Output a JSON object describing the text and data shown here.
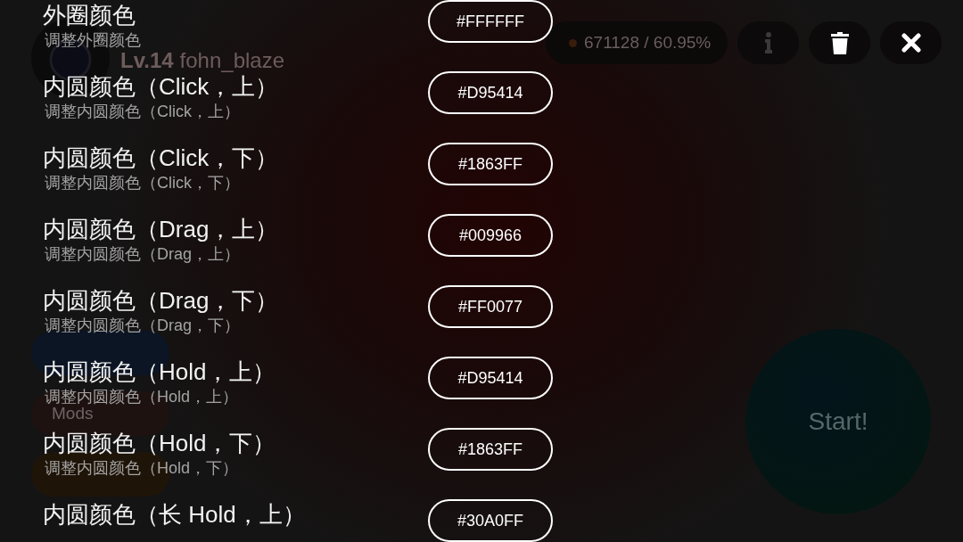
{
  "background": {
    "player": {
      "level": "Lv.14",
      "username": "fohn_blaze"
    },
    "score": "671128 / 60.95%",
    "side_pills": [
      {
        "color": "#0c1524"
      },
      {
        "label": "Mods",
        "color": "#1d1210"
      },
      {
        "color": "#1f1408"
      }
    ],
    "start_button": "Start!"
  },
  "settings": [
    {
      "title": "外圈颜色",
      "subtitle": "调整外圈颜色",
      "value": "#FFFFFF"
    },
    {
      "title": "内圆颜色（Click，上）",
      "subtitle": "调整内圆颜色（Click，上）",
      "value": "#D95414"
    },
    {
      "title": "内圆颜色（Click，下）",
      "subtitle": "调整内圆颜色（Click，下）",
      "value": "#1863FF"
    },
    {
      "title": "内圆颜色（Drag，上）",
      "subtitle": "调整内圆颜色（Drag，上）",
      "value": "#009966"
    },
    {
      "title": "内圆颜色（Drag，下）",
      "subtitle": "调整内圆颜色（Drag，下）",
      "value": "#FF0077"
    },
    {
      "title": "内圆颜色（Hold，上）",
      "subtitle": "调整内圆颜色（Hold，上）",
      "value": "#D95414"
    },
    {
      "title": "内圆颜色（Hold，下）",
      "subtitle": "调整内圆颜色（Hold，下）",
      "value": "#1863FF"
    },
    {
      "title": "内圆颜色（长 Hold，上）",
      "value": "#30A0FF"
    }
  ]
}
